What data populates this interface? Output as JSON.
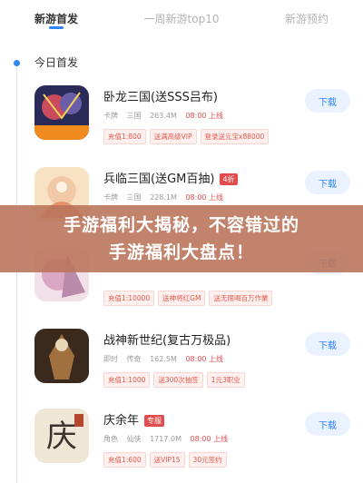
{
  "tabs": [
    {
      "label": "新游首发",
      "active": true
    },
    {
      "label": "一周新游top10",
      "active": false
    },
    {
      "label": "新游预约",
      "active": false
    }
  ],
  "section_title": "今日首发",
  "download_label": "下载",
  "games": [
    {
      "name": "卧龙三国(送SSS吕布)",
      "tag": "",
      "genre": "卡牌",
      "platform": "三国",
      "size": "263.4M",
      "time": "08:00 上线",
      "perks": [
        "充值1:800",
        "送满高级VIP",
        "登录送元宝x88000"
      ],
      "icon_text": "送赵云&吕布",
      "icon_colors": [
        "#2a2a58",
        "#c94b5d",
        "#f3d25a"
      ]
    },
    {
      "name": "兵临三国(送GM百抽)",
      "tag": "4折",
      "genre": "卡牌",
      "platform": "三国",
      "size": "228.1M",
      "time": "08:00 上线",
      "perks": [],
      "icon_text": "",
      "icon_colors": [
        "#f2c9a6",
        "#e58f6b",
        "#f7e3c4"
      ]
    },
    {
      "name": "",
      "tag": "",
      "genre": "",
      "platform": "",
      "size": "",
      "time": "",
      "perks": [
        "充值1:10000",
        "送神将红GM",
        "送无限喝百万作業"
      ],
      "icon_text": "",
      "icon_colors": [
        "#d9a7c4",
        "#f3e1ea",
        "#b98aa9"
      ]
    },
    {
      "name": "战神新世纪(复古万极品)",
      "tag": "",
      "genre": "即时",
      "platform": "传奇",
      "size": "162.5M",
      "time": "08:00 上线",
      "perks": [
        "充值1:1000",
        "送300次抽签",
        "1元3职业"
      ],
      "icon_text": "",
      "icon_colors": [
        "#3a2a1e",
        "#a0703e",
        "#e8d7b6"
      ]
    },
    {
      "name": "庆余年",
      "tag": "专服",
      "genre": "角色",
      "platform": "仙侠",
      "size": "1717.0M",
      "time": "08:00 上线",
      "perks": [
        "充值1:600",
        "送VIP15",
        "30元签约"
      ],
      "icon_text": "庆",
      "icon_colors": [
        "#efe6d6",
        "#3b332c",
        "#b5472e"
      ]
    }
  ],
  "banner": {
    "line1": "手游福利大揭秘，不容错过的",
    "line2": "手游福利大盘点！"
  }
}
